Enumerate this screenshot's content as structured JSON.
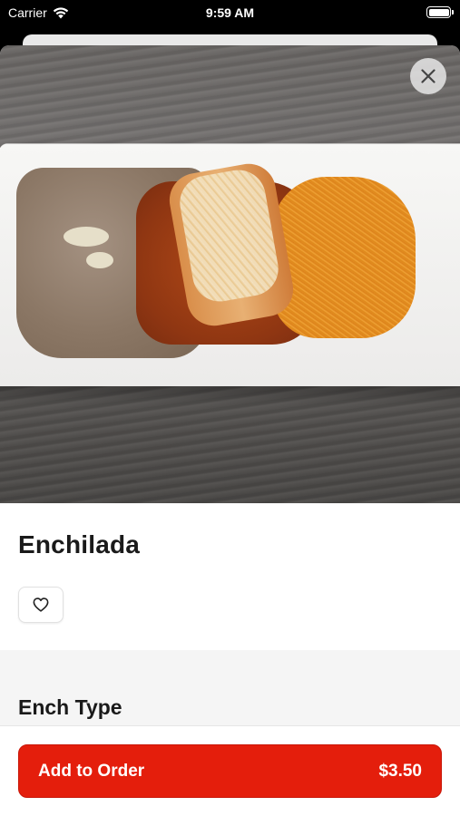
{
  "status_bar": {
    "carrier": "Carrier",
    "time": "9:59 AM"
  },
  "item": {
    "name": "Enchilada"
  },
  "close_icon": "close-icon",
  "favorite_icon": "heart-outline-icon",
  "options": {
    "section_title": "Ench Type"
  },
  "footer": {
    "add_label": "Add to Order",
    "price": "$3.50",
    "accent_color": "#e41e0c"
  }
}
